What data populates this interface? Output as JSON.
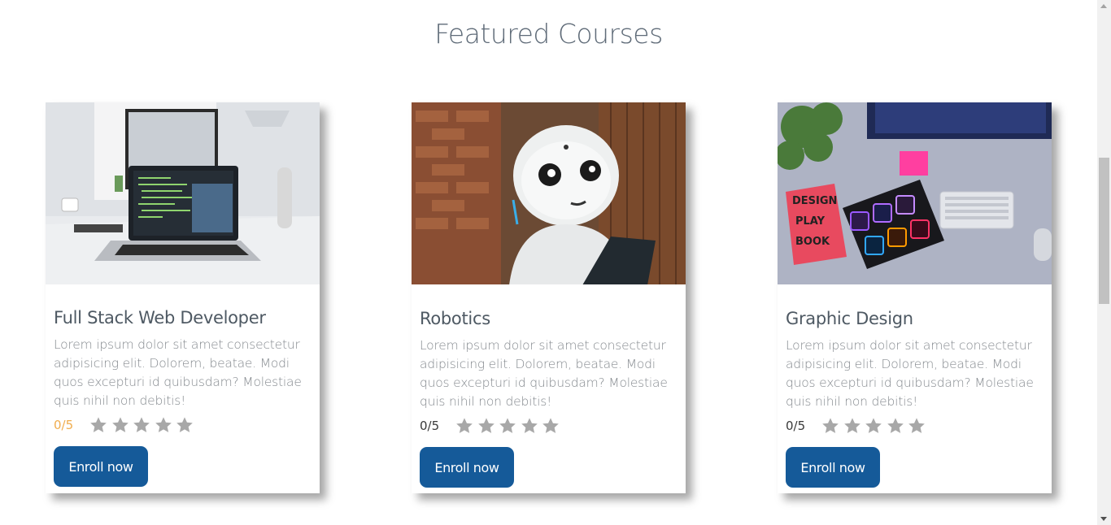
{
  "section": {
    "title": "Featured Courses"
  },
  "courses": [
    {
      "title": "Full Stack Web Developer",
      "description": "Lorem ipsum dolor sit amet consectetur adipisicing elit. Dolorem, beatae. Modi quos excepturi id quibusdam? Molestiae quis nihil non debitis!",
      "rating": "0/5",
      "enroll_label": "Enroll now",
      "image_icon": "laptop-desk-image"
    },
    {
      "title": "Robotics",
      "description": "Lorem ipsum dolor sit amet consectetur adipisicing elit. Dolorem, beatae. Modi quos excepturi id quibusdam? Molestiae quis nihil non debitis!",
      "rating": "0/5",
      "enroll_label": "Enroll now",
      "image_icon": "robot-image"
    },
    {
      "title": "Graphic Design",
      "description": "Lorem ipsum dolor sit amet consectetur adipisicing elit. Dolorem, beatae. Modi quos excepturi id quibusdam? Molestiae quis nihil non debitis!",
      "rating": "0/5",
      "enroll_label": "Enroll now",
      "image_icon": "design-desk-image"
    }
  ],
  "colors": {
    "accent": "#155a99",
    "star": "#a8a8a8",
    "rating_highlight": "#f0ad4e"
  }
}
